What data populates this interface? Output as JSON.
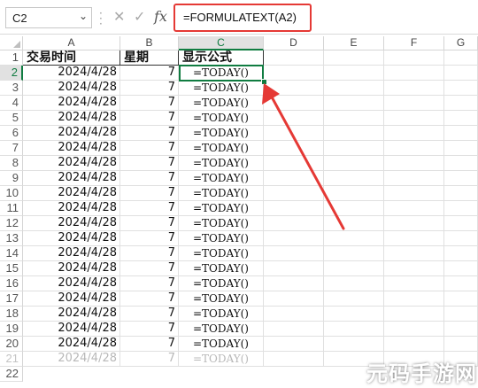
{
  "formula_bar": {
    "name_box": "C2",
    "cancel_icon": "✕",
    "enter_icon": "✓",
    "fx_icon": "fx",
    "formula": "=FORMULATEXT(A2)",
    "highlight_color": "#e53935"
  },
  "sheet": {
    "columns": [
      "A",
      "B",
      "C",
      "D",
      "E",
      "F",
      "G"
    ],
    "active_column": "C",
    "active_row": "2",
    "header_row": {
      "row_number": "1",
      "a": "交易时间",
      "b": "星期",
      "c": "显示公式"
    },
    "rows": [
      {
        "n": "2",
        "a": "2024/4/28",
        "b": "7",
        "c": "=TODAY()"
      },
      {
        "n": "3",
        "a": "2024/4/28",
        "b": "7",
        "c": "=TODAY()"
      },
      {
        "n": "4",
        "a": "2024/4/28",
        "b": "7",
        "c": "=TODAY()"
      },
      {
        "n": "5",
        "a": "2024/4/28",
        "b": "7",
        "c": "=TODAY()"
      },
      {
        "n": "6",
        "a": "2024/4/28",
        "b": "7",
        "c": "=TODAY()"
      },
      {
        "n": "7",
        "a": "2024/4/28",
        "b": "7",
        "c": "=TODAY()"
      },
      {
        "n": "8",
        "a": "2024/4/28",
        "b": "7",
        "c": "=TODAY()"
      },
      {
        "n": "9",
        "a": "2024/4/28",
        "b": "7",
        "c": "=TODAY()"
      },
      {
        "n": "10",
        "a": "2024/4/28",
        "b": "7",
        "c": "=TODAY()"
      },
      {
        "n": "11",
        "a": "2024/4/28",
        "b": "7",
        "c": "=TODAY()"
      },
      {
        "n": "12",
        "a": "2024/4/28",
        "b": "7",
        "c": "=TODAY()"
      },
      {
        "n": "13",
        "a": "2024/4/28",
        "b": "7",
        "c": "=TODAY()"
      },
      {
        "n": "14",
        "a": "2024/4/28",
        "b": "7",
        "c": "=TODAY()"
      },
      {
        "n": "15",
        "a": "2024/4/28",
        "b": "7",
        "c": "=TODAY()"
      },
      {
        "n": "16",
        "a": "2024/4/28",
        "b": "7",
        "c": "=TODAY()"
      },
      {
        "n": "17",
        "a": "2024/4/28",
        "b": "7",
        "c": "=TODAY()"
      },
      {
        "n": "18",
        "a": "2024/4/28",
        "b": "7",
        "c": "=TODAY()"
      },
      {
        "n": "19",
        "a": "2024/4/28",
        "b": "7",
        "c": "=TODAY()"
      },
      {
        "n": "20",
        "a": "2024/4/28",
        "b": "7",
        "c": "=TODAY()"
      },
      {
        "n": "21",
        "a": "2024/4/28",
        "b": "7",
        "c": "=TODAY()"
      }
    ],
    "trailing_row": "22",
    "accent_color": "#107c41"
  },
  "annotation": {
    "arrow_color": "#e53935"
  },
  "watermark": {
    "text": "元码手游网"
  }
}
